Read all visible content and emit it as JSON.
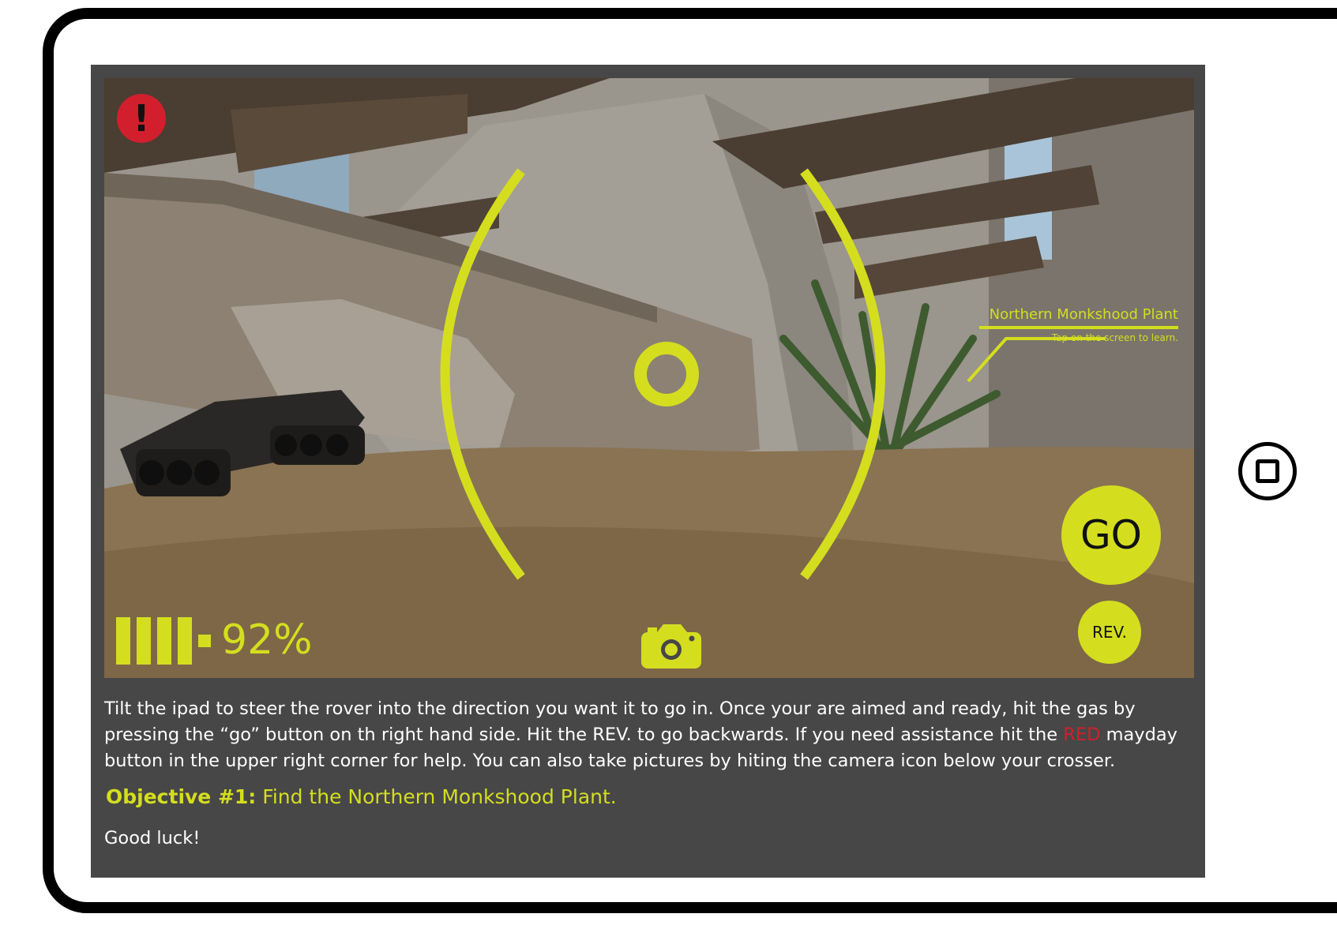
{
  "device": {
    "home_button_icon": "home-square-icon"
  },
  "hud": {
    "mayday_label": "!",
    "mayday_color": "#d11f2e",
    "accent_color": "#d4de1f",
    "target": {
      "name": "Northern Monkshood Plant",
      "hint": "Tap on the screen to learn."
    },
    "go_label": "GO",
    "rev_label": "REV.",
    "battery": {
      "percent_text": "92%",
      "level": 0.92
    },
    "camera_icon": "camera-icon",
    "reticle_icon": "crosshair-icon"
  },
  "instructions": {
    "part1": "Tilt the ipad to steer the rover into the direction you want it to go in. Once your are aimed and ready, hit the gas by pressing the “go” button on th right hand side. Hit the REV. to go backwards. If you need assistance hit the ",
    "red_word": "RED",
    "part2": " mayday button in the upper right corner for help. You can also take pictures by hiting the camera icon below your crosser."
  },
  "objective": {
    "label": "Objective #1:",
    "text": " Find the Northern Monkshood Plant."
  },
  "closing": "Good luck!"
}
